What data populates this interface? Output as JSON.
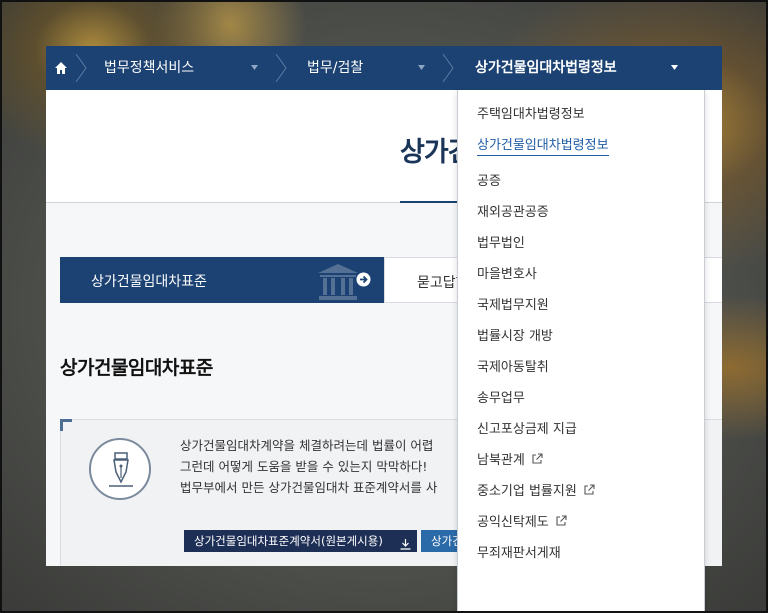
{
  "nav": {
    "home_icon": "home-icon",
    "items": [
      {
        "label": "법무정책서비스"
      },
      {
        "label": "법무/검찰"
      },
      {
        "label": "상가건물임대차법령정보"
      }
    ]
  },
  "page": {
    "title": "상가건"
  },
  "tabs": {
    "active_label": "상가건물임대차표준",
    "second_label": "묻고답하"
  },
  "section": {
    "title": "상가건물임대차표준"
  },
  "info": {
    "lines": [
      "상가건물임대차계약을 체결하려는데 법률이 어렵",
      "그런데 어떻게 도움을 받을 수 있는지 막막하다!",
      "법무부에서 만든 상가건물임대차 표준계약서를 사"
    ],
    "download_button_1": "상가건물임대차표준계약서(원본게시용)",
    "download_button_2": "상가건"
  },
  "dropdown": {
    "items": [
      {
        "label": "주택임대차법령정보",
        "external": false
      },
      {
        "label": "상가건물임대차법령정보",
        "external": false,
        "active": true
      },
      {
        "label": "공증",
        "external": false
      },
      {
        "label": "재외공관공증",
        "external": false
      },
      {
        "label": "법무법인",
        "external": false
      },
      {
        "label": "마을변호사",
        "external": false
      },
      {
        "label": "국제법무지원",
        "external": false
      },
      {
        "label": "법률시장 개방",
        "external": false
      },
      {
        "label": "국제아동탈취",
        "external": false
      },
      {
        "label": "송무업무",
        "external": false
      },
      {
        "label": "신고포상금제 지급",
        "external": false
      },
      {
        "label": "남북관계",
        "external": true
      },
      {
        "label": "중소기업 법률지원",
        "external": true
      },
      {
        "label": "공익신탁제도",
        "external": true
      },
      {
        "label": "무죄재판서게재",
        "external": false
      }
    ]
  },
  "colors": {
    "navbar": "#1b4272",
    "active_link": "#1f5da6",
    "dark_button": "#1e2f55",
    "blue_button": "#2b6aa8"
  }
}
